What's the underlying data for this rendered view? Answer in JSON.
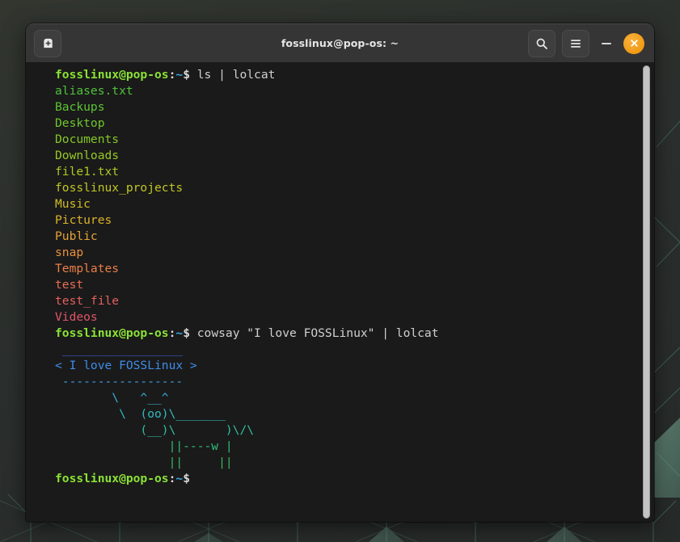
{
  "window": {
    "title": "fosslinux@pop-os: ~",
    "new_tab_icon": "new-tab-icon",
    "search_icon": "search-icon",
    "menu_icon": "hamburger-menu-icon",
    "minimize_label": "Minimize",
    "close_label": "Close",
    "accent_close_color": "#f5a623"
  },
  "terminal": {
    "background": "#1a1a1a",
    "prompt": {
      "user_host": "fosslinux@pop-os",
      "colon": ":",
      "path": "~",
      "sigil": "$",
      "user_host_color": "#8ae234",
      "path_color": "#34a8e0",
      "sigil_color": "#d8d8d8"
    },
    "lines": [
      {
        "type": "prompt",
        "command": " ls | lolcat",
        "command_color": "#d0d0d0"
      },
      {
        "type": "out",
        "text": "aliases.txt",
        "color": "#4ec13a"
      },
      {
        "type": "out",
        "text": "Backups",
        "color": "#5dc432"
      },
      {
        "type": "out",
        "text": "Desktop",
        "color": "#6fc62c"
      },
      {
        "type": "out",
        "text": "Documents",
        "color": "#83c827"
      },
      {
        "type": "out",
        "text": "Downloads",
        "color": "#97c924"
      },
      {
        "type": "out",
        "text": "file1.txt",
        "color": "#acc922"
      },
      {
        "type": "out",
        "text": "fosslinux_projects",
        "color": "#c0c623"
      },
      {
        "type": "out",
        "text": "Music",
        "color": "#d0bd27"
      },
      {
        "type": "out",
        "text": "Pictures",
        "color": "#dcb12d"
      },
      {
        "type": "out",
        "text": "Public",
        "color": "#e4a235"
      },
      {
        "type": "out",
        "text": "snap",
        "color": "#e9913e"
      },
      {
        "type": "out",
        "text": "Templates",
        "color": "#ea7f48"
      },
      {
        "type": "out",
        "text": "test",
        "color": "#e96e53"
      },
      {
        "type": "out",
        "text": "test_file",
        "color": "#e5605e"
      },
      {
        "type": "out",
        "text": "Videos",
        "color": "#de5568"
      },
      {
        "type": "prompt",
        "command": " cowsay \"I love FOSSLinux\" | lolcat",
        "command_color": "#d0d0d0"
      },
      {
        "type": "out",
        "text": " _________________",
        "color": "#3f63e0"
      },
      {
        "type": "out",
        "text": "< I love FOSSLinux >",
        "color": "#3f8ce8"
      },
      {
        "type": "out",
        "text": " -----------------",
        "color": "#3f9fe4"
      },
      {
        "type": "out",
        "text": "        \\   ^__^",
        "color": "#38b0d8"
      },
      {
        "type": "out",
        "text": "         \\  (oo)\\_______",
        "color": "#33bbc0"
      },
      {
        "type": "out",
        "text": "            (__)\\       )\\/\\",
        "color": "#30bf9e"
      },
      {
        "type": "out",
        "text": "                ||----w |",
        "color": "#33bd7a"
      },
      {
        "type": "out",
        "text": "                ||     ||",
        "color": "#3bb85d"
      },
      {
        "type": "prompt",
        "command": "",
        "command_color": "#d0d0d0"
      }
    ]
  },
  "scrollbar": {
    "thumb_color": "#c3c3c3",
    "position_percent": 100
  }
}
